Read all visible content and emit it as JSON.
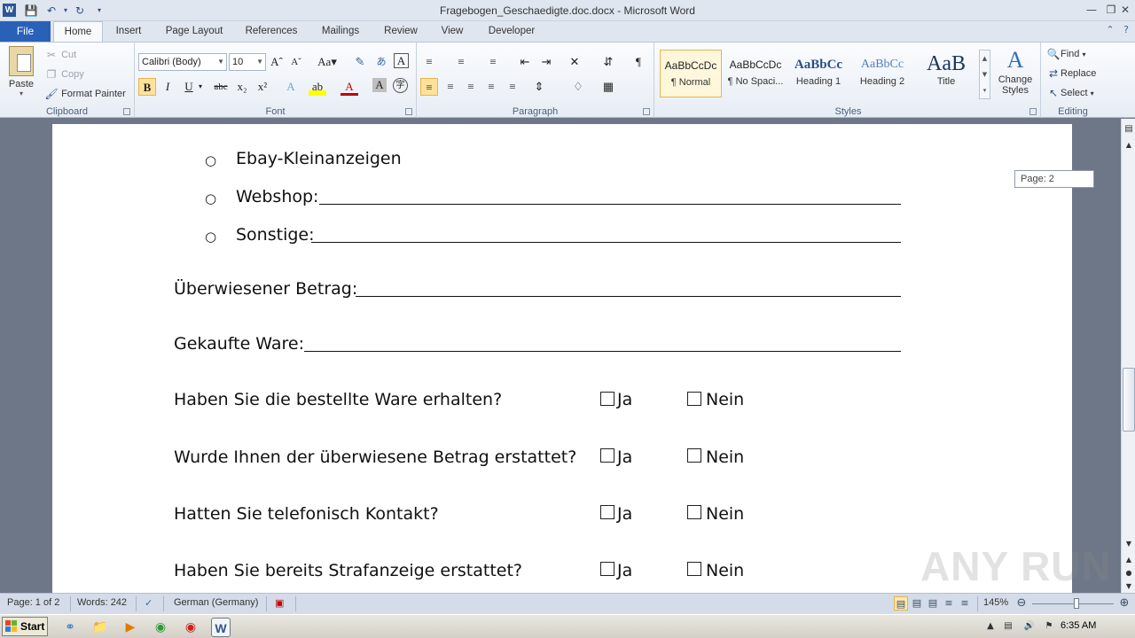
{
  "window": {
    "title": "Fragebogen_Geschaedigte.doc.docx - Microsoft Word",
    "app_icon_letter": "W"
  },
  "tabs": {
    "file": "File",
    "items": [
      "Home",
      "Insert",
      "Page Layout",
      "References",
      "Mailings",
      "Review",
      "View",
      "Developer"
    ],
    "active": "Home"
  },
  "ribbon": {
    "clipboard": {
      "label": "Clipboard",
      "paste": "Paste",
      "cut": "Cut",
      "copy": "Copy",
      "format_painter": "Format Painter"
    },
    "font": {
      "label": "Font",
      "font_name": "Calibri (Body)",
      "font_size": "10"
    },
    "paragraph": {
      "label": "Paragraph"
    },
    "styles": {
      "label": "Styles",
      "items": [
        {
          "preview": "AaBbCcDc",
          "name": "¶ Normal",
          "selected": true
        },
        {
          "preview": "AaBbCcDc",
          "name": "¶ No Spaci..."
        },
        {
          "preview": "AaBbCc",
          "name": "Heading 1"
        },
        {
          "preview": "AaBbCc",
          "name": "Heading 2"
        },
        {
          "preview": "AaB",
          "name": "Title"
        }
      ],
      "change_styles": "Change Styles"
    },
    "editing": {
      "label": "Editing",
      "find": "Find",
      "replace": "Replace",
      "select": "Select"
    }
  },
  "document": {
    "bullets": [
      "Ebay-Kleinanzeigen",
      "Webshop:",
      "Sonstige:"
    ],
    "fields": [
      "Überwiesener  Betrag:",
      "Gekaufte Ware:"
    ],
    "questions": [
      "Haben Sie die bestellte Ware erhalten?",
      "Wurde Ihnen der überwiesene Betrag erstattet?",
      "Hatten Sie telefonisch Kontakt?",
      "Haben Sie bereits Strafanzeige erstattet?"
    ],
    "yes_label": "Ja",
    "no_label": "Nein",
    "page_tooltip": "Page: 2"
  },
  "statusbar": {
    "page": "Page: 1 of 2",
    "words": "Words: 242",
    "language": "German (Germany)",
    "zoom": "145%"
  },
  "taskbar": {
    "start": "Start",
    "clock": "6:35 AM"
  },
  "watermark": "ANY RUN",
  "colors": {
    "file_tab": "#2a61b8",
    "doc_background": "#6e7787",
    "selected_style": "#fff7dc"
  }
}
